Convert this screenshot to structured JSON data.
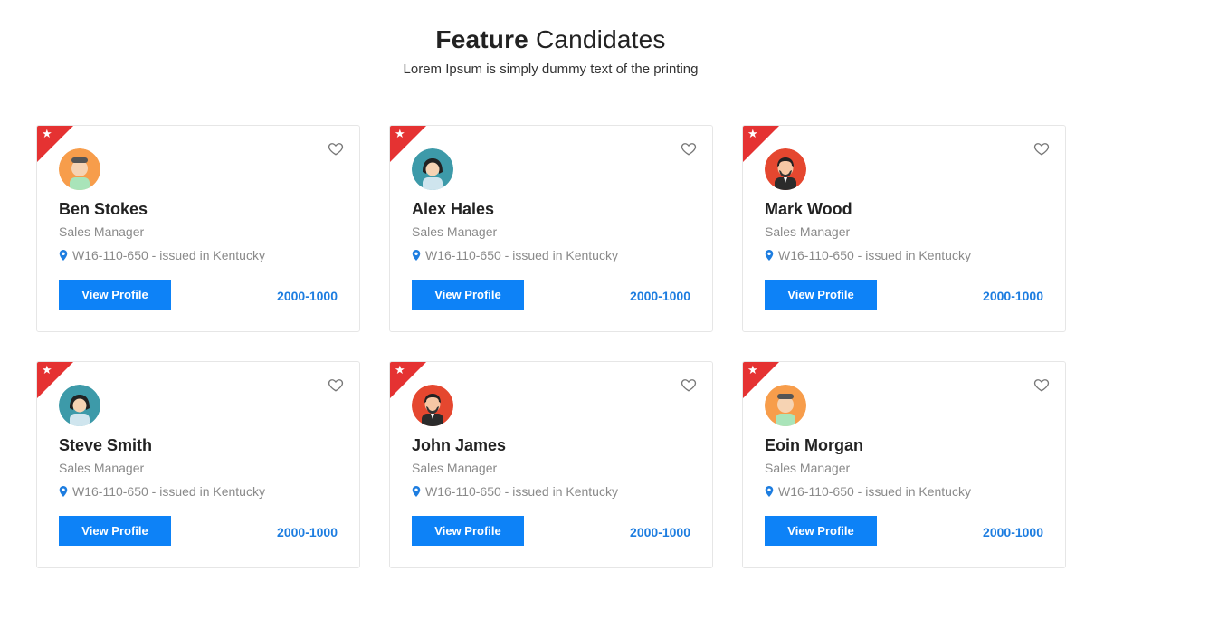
{
  "header": {
    "title_strong": "Feature",
    "title_rest": "Candidates",
    "subtitle": "Lorem Ipsum is simply dummy text of the printing"
  },
  "colors": {
    "accent": "#0d82f7",
    "ribbon": "#e53232",
    "salary": "#1d7de0"
  },
  "candidates": [
    {
      "name": "Ben Stokes",
      "role": "Sales Manager",
      "location": "W16-110-650 - issued in Kentucky",
      "button_label": "View Profile",
      "salary": "2000-1000",
      "avatar": "man-orange-avatar"
    },
    {
      "name": "Alex Hales",
      "role": "Sales Manager",
      "location": "W16-110-650 - issued in Kentucky",
      "button_label": "View Profile",
      "salary": "2000-1000",
      "avatar": "woman-teal-avatar"
    },
    {
      "name": "Mark Wood",
      "role": "Sales Manager",
      "location": "W16-110-650 - issued in Kentucky",
      "button_label": "View Profile",
      "salary": "2000-1000",
      "avatar": "man-red-avatar"
    },
    {
      "name": "Steve Smith",
      "role": "Sales Manager",
      "location": "W16-110-650 - issued in Kentucky",
      "button_label": "View Profile",
      "salary": "2000-1000",
      "avatar": "woman-teal-avatar"
    },
    {
      "name": "John James",
      "role": "Sales Manager",
      "location": "W16-110-650 - issued in Kentucky",
      "button_label": "View Profile",
      "salary": "2000-1000",
      "avatar": "man-red-avatar"
    },
    {
      "name": "Eoin Morgan",
      "role": "Sales Manager",
      "location": "W16-110-650 - issued in Kentucky",
      "button_label": "View Profile",
      "salary": "2000-1000",
      "avatar": "man-orange-avatar"
    }
  ]
}
